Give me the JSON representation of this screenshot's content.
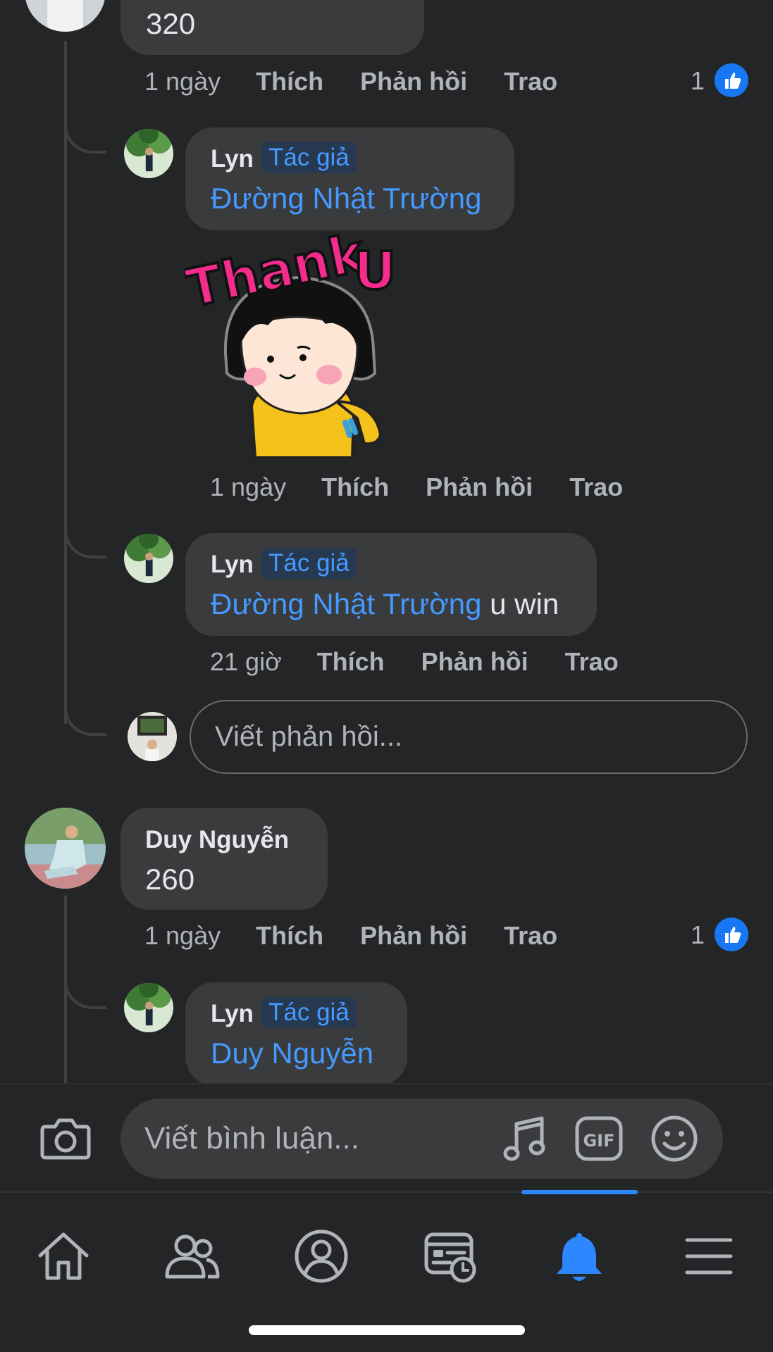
{
  "comments": [
    {
      "text": "320",
      "time": "1 ngày",
      "actions": [
        "Thích",
        "Phản hồi",
        "Trao"
      ],
      "likes": "1",
      "replies": [
        {
          "name": "Lyn",
          "badge": "Tác giả",
          "mention": "Đường Nhật Trường",
          "text": "",
          "sticker": "Thank U",
          "time": "1 ngày",
          "actions": [
            "Thích",
            "Phản hồi",
            "Trao"
          ]
        },
        {
          "name": "Lyn",
          "badge": "Tác giả",
          "mention": "Đường Nhật Trường",
          "text": " u win",
          "time": "21 giờ",
          "actions": [
            "Thích",
            "Phản hồi",
            "Trao"
          ]
        }
      ],
      "reply_placeholder": "Viết phản hồi..."
    },
    {
      "name": "Duy Nguyễn",
      "text": "260",
      "time": "1 ngày",
      "actions": [
        "Thích",
        "Phản hồi",
        "Trao"
      ],
      "likes": "1",
      "replies": [
        {
          "name": "Lyn",
          "badge": "Tác giả",
          "mention": "Duy Nguyễn",
          "text": ""
        }
      ]
    }
  ],
  "composer": {
    "placeholder": "Viết bình luận...",
    "icons": [
      "camera-icon",
      "music-icon",
      "gif-icon",
      "emoji-icon"
    ]
  },
  "tabbar": {
    "tabs": [
      "home-icon",
      "friends-icon",
      "profile-icon",
      "watch-icon",
      "notifications-icon",
      "menu-icon"
    ],
    "active": "notifications-icon"
  },
  "colors": {
    "background": "#242526",
    "bubble": "#3a3b3c",
    "mention": "#4599ff",
    "accent": "#1877f2",
    "muted": "#b0b3b8"
  }
}
